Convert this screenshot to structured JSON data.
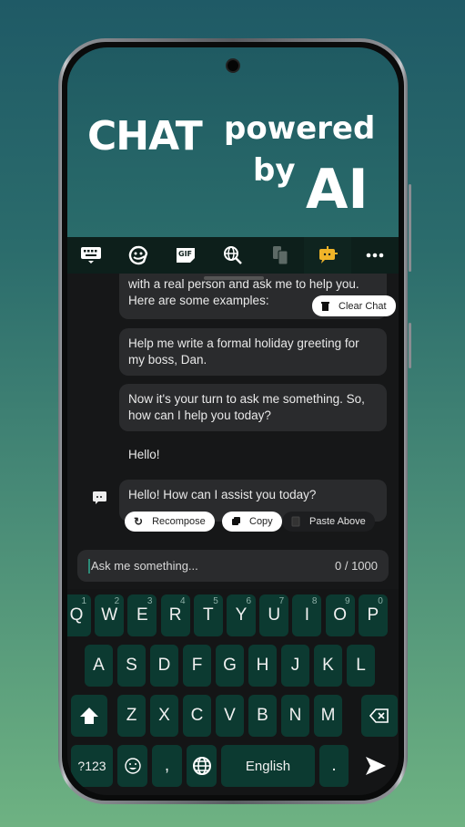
{
  "hero": {
    "line1": "CHAT",
    "line2": "powered",
    "line3": "by",
    "line4": "AI"
  },
  "toolbar": {
    "items": [
      {
        "name": "keyboard-icon",
        "label": "Keyboard"
      },
      {
        "name": "sticker-icon",
        "label": "Stickers"
      },
      {
        "name": "gif-icon",
        "label": "GIF"
      },
      {
        "name": "web-search-icon",
        "label": "Search"
      },
      {
        "name": "clipboard-icon",
        "label": "Clipboard"
      },
      {
        "name": "ai-chat-icon",
        "label": "AI Chat"
      },
      {
        "name": "more-icon",
        "label": "More"
      }
    ],
    "active_color": "#f0b429"
  },
  "chat": {
    "clear_label": "Clear Chat",
    "messages": [
      {
        "role": "ai",
        "text": "with a real person and ask me to help you. Here are some examples:"
      },
      {
        "role": "ai",
        "text": "Help me write a formal holiday greeting for my boss, Dan."
      },
      {
        "role": "ai",
        "text": "Now it's your turn to ask me something. So, how can I help you today?"
      },
      {
        "role": "user",
        "text": "Hello!"
      },
      {
        "role": "ai",
        "text": "Hello! How can I assist you today?"
      }
    ],
    "actions": {
      "recompose": "Recompose",
      "copy": "Copy",
      "paste": "Paste Above"
    }
  },
  "input": {
    "placeholder": "Ask me something...",
    "count": "0 / 1000"
  },
  "keyboard": {
    "row1": [
      {
        "k": "Q",
        "h": "1"
      },
      {
        "k": "W",
        "h": "2"
      },
      {
        "k": "E",
        "h": "3"
      },
      {
        "k": "R",
        "h": "4"
      },
      {
        "k": "T",
        "h": "5"
      },
      {
        "k": "Y",
        "h": "6"
      },
      {
        "k": "U",
        "h": "7"
      },
      {
        "k": "I",
        "h": "8"
      },
      {
        "k": "O",
        "h": "9"
      },
      {
        "k": "P",
        "h": "0"
      }
    ],
    "row2": [
      "A",
      "S",
      "D",
      "F",
      "G",
      "H",
      "J",
      "K",
      "L"
    ],
    "row3": [
      "Z",
      "X",
      "C",
      "V",
      "B",
      "N",
      "M"
    ],
    "symbols": "?123",
    "comma": ",",
    "space": "English",
    "period": "."
  }
}
